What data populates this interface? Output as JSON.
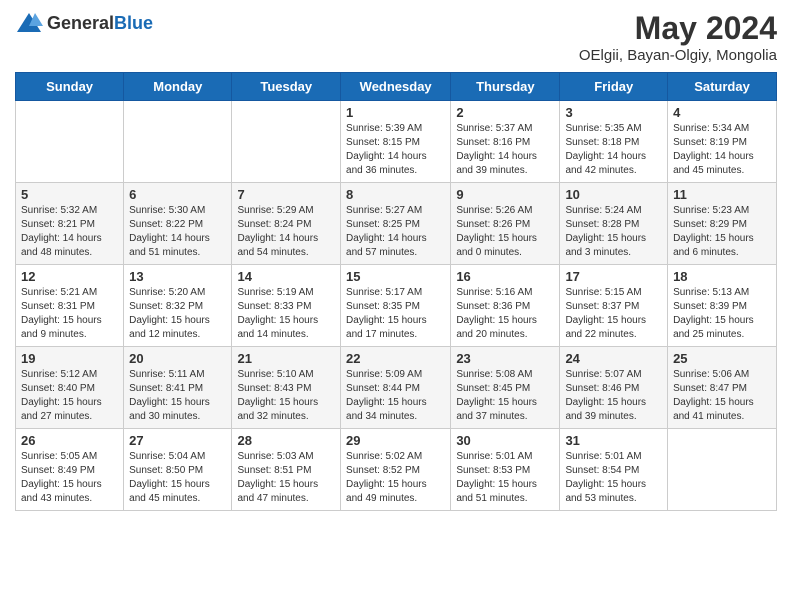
{
  "logo": {
    "general": "General",
    "blue": "Blue"
  },
  "header": {
    "month": "May 2024",
    "location": "OElgii, Bayan-Olgiy, Mongolia"
  },
  "days_of_week": [
    "Sunday",
    "Monday",
    "Tuesday",
    "Wednesday",
    "Thursday",
    "Friday",
    "Saturday"
  ],
  "weeks": [
    [
      {
        "day": "",
        "info": ""
      },
      {
        "day": "",
        "info": ""
      },
      {
        "day": "",
        "info": ""
      },
      {
        "day": "1",
        "info": "Sunrise: 5:39 AM\nSunset: 8:15 PM\nDaylight: 14 hours\nand 36 minutes."
      },
      {
        "day": "2",
        "info": "Sunrise: 5:37 AM\nSunset: 8:16 PM\nDaylight: 14 hours\nand 39 minutes."
      },
      {
        "day": "3",
        "info": "Sunrise: 5:35 AM\nSunset: 8:18 PM\nDaylight: 14 hours\nand 42 minutes."
      },
      {
        "day": "4",
        "info": "Sunrise: 5:34 AM\nSunset: 8:19 PM\nDaylight: 14 hours\nand 45 minutes."
      }
    ],
    [
      {
        "day": "5",
        "info": "Sunrise: 5:32 AM\nSunset: 8:21 PM\nDaylight: 14 hours\nand 48 minutes."
      },
      {
        "day": "6",
        "info": "Sunrise: 5:30 AM\nSunset: 8:22 PM\nDaylight: 14 hours\nand 51 minutes."
      },
      {
        "day": "7",
        "info": "Sunrise: 5:29 AM\nSunset: 8:24 PM\nDaylight: 14 hours\nand 54 minutes."
      },
      {
        "day": "8",
        "info": "Sunrise: 5:27 AM\nSunset: 8:25 PM\nDaylight: 14 hours\nand 57 minutes."
      },
      {
        "day": "9",
        "info": "Sunrise: 5:26 AM\nSunset: 8:26 PM\nDaylight: 15 hours\nand 0 minutes."
      },
      {
        "day": "10",
        "info": "Sunrise: 5:24 AM\nSunset: 8:28 PM\nDaylight: 15 hours\nand 3 minutes."
      },
      {
        "day": "11",
        "info": "Sunrise: 5:23 AM\nSunset: 8:29 PM\nDaylight: 15 hours\nand 6 minutes."
      }
    ],
    [
      {
        "day": "12",
        "info": "Sunrise: 5:21 AM\nSunset: 8:31 PM\nDaylight: 15 hours\nand 9 minutes."
      },
      {
        "day": "13",
        "info": "Sunrise: 5:20 AM\nSunset: 8:32 PM\nDaylight: 15 hours\nand 12 minutes."
      },
      {
        "day": "14",
        "info": "Sunrise: 5:19 AM\nSunset: 8:33 PM\nDaylight: 15 hours\nand 14 minutes."
      },
      {
        "day": "15",
        "info": "Sunrise: 5:17 AM\nSunset: 8:35 PM\nDaylight: 15 hours\nand 17 minutes."
      },
      {
        "day": "16",
        "info": "Sunrise: 5:16 AM\nSunset: 8:36 PM\nDaylight: 15 hours\nand 20 minutes."
      },
      {
        "day": "17",
        "info": "Sunrise: 5:15 AM\nSunset: 8:37 PM\nDaylight: 15 hours\nand 22 minutes."
      },
      {
        "day": "18",
        "info": "Sunrise: 5:13 AM\nSunset: 8:39 PM\nDaylight: 15 hours\nand 25 minutes."
      }
    ],
    [
      {
        "day": "19",
        "info": "Sunrise: 5:12 AM\nSunset: 8:40 PM\nDaylight: 15 hours\nand 27 minutes."
      },
      {
        "day": "20",
        "info": "Sunrise: 5:11 AM\nSunset: 8:41 PM\nDaylight: 15 hours\nand 30 minutes."
      },
      {
        "day": "21",
        "info": "Sunrise: 5:10 AM\nSunset: 8:43 PM\nDaylight: 15 hours\nand 32 minutes."
      },
      {
        "day": "22",
        "info": "Sunrise: 5:09 AM\nSunset: 8:44 PM\nDaylight: 15 hours\nand 34 minutes."
      },
      {
        "day": "23",
        "info": "Sunrise: 5:08 AM\nSunset: 8:45 PM\nDaylight: 15 hours\nand 37 minutes."
      },
      {
        "day": "24",
        "info": "Sunrise: 5:07 AM\nSunset: 8:46 PM\nDaylight: 15 hours\nand 39 minutes."
      },
      {
        "day": "25",
        "info": "Sunrise: 5:06 AM\nSunset: 8:47 PM\nDaylight: 15 hours\nand 41 minutes."
      }
    ],
    [
      {
        "day": "26",
        "info": "Sunrise: 5:05 AM\nSunset: 8:49 PM\nDaylight: 15 hours\nand 43 minutes."
      },
      {
        "day": "27",
        "info": "Sunrise: 5:04 AM\nSunset: 8:50 PM\nDaylight: 15 hours\nand 45 minutes."
      },
      {
        "day": "28",
        "info": "Sunrise: 5:03 AM\nSunset: 8:51 PM\nDaylight: 15 hours\nand 47 minutes."
      },
      {
        "day": "29",
        "info": "Sunrise: 5:02 AM\nSunset: 8:52 PM\nDaylight: 15 hours\nand 49 minutes."
      },
      {
        "day": "30",
        "info": "Sunrise: 5:01 AM\nSunset: 8:53 PM\nDaylight: 15 hours\nand 51 minutes."
      },
      {
        "day": "31",
        "info": "Sunrise: 5:01 AM\nSunset: 8:54 PM\nDaylight: 15 hours\nand 53 minutes."
      },
      {
        "day": "",
        "info": ""
      }
    ]
  ]
}
